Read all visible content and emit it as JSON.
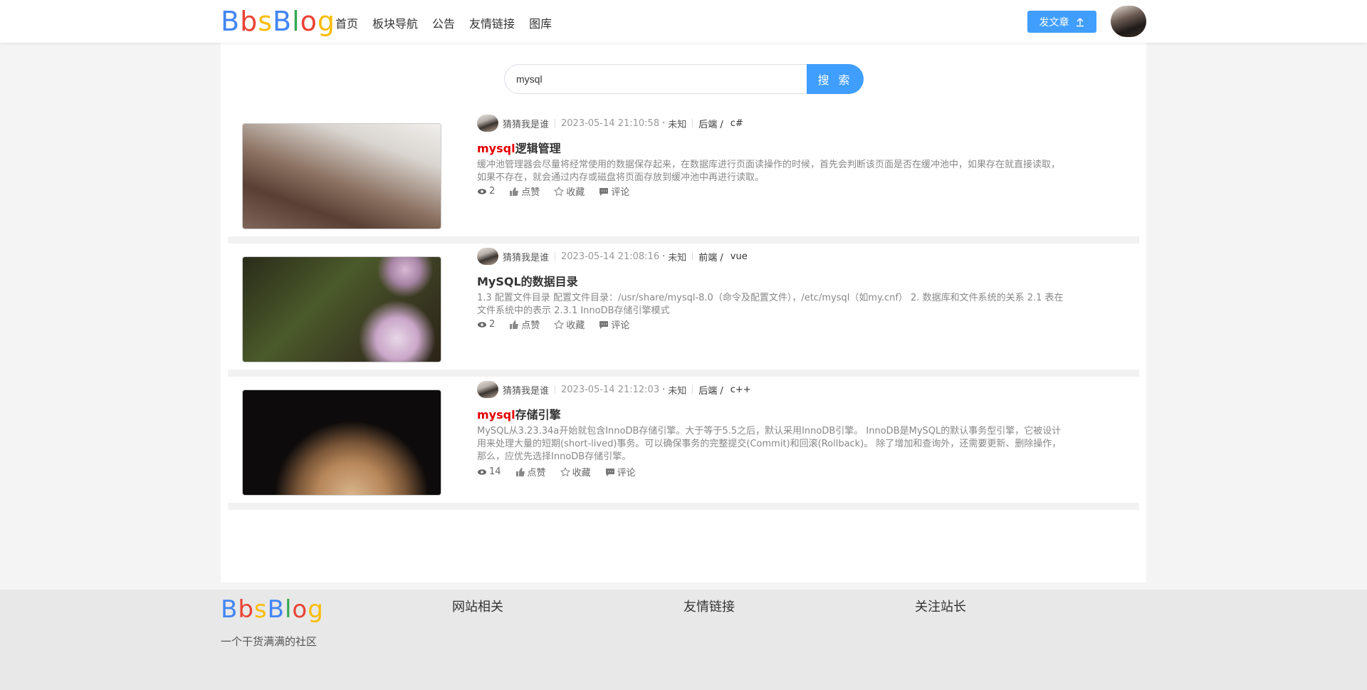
{
  "header": {
    "logo": [
      "B",
      "b",
      "s",
      "B",
      "l",
      "o",
      "g"
    ],
    "logo_colors": [
      "#4285f4",
      "#ea4335",
      "#fbbc05",
      "#4285f4",
      "#34a853",
      "#ea4335",
      "#fbbc05"
    ],
    "nav": [
      "首页",
      "板块导航",
      "公告",
      "友情链接",
      "图库"
    ],
    "post_button": "发文章"
  },
  "search": {
    "value": "mysql",
    "button": "搜 索"
  },
  "articles": [
    {
      "author": "猜猜我是谁",
      "date": "2023-05-14 21:10:58",
      "location": "未知",
      "category": "后端 /",
      "tag": "c#",
      "title_highlight": "mysql",
      "title_rest": "逻辑管理",
      "desc": "缓冲池管理器会尽量将经常使用的数据保存起来，在数据库进行页面读操作的时候，首先会判断该页面是否在缓冲池中，如果存在就直接读取，如果不存在，就会通过内存或磁盘将页面存放到缓冲池中再进行读取。",
      "views": "2",
      "like": "点赞",
      "collect": "收藏",
      "comment": "评论"
    },
    {
      "author": "猜猜我是谁",
      "date": "2023-05-14 21:08:16",
      "location": "未知",
      "category": "前端 /",
      "tag": "vue",
      "title_highlight": "",
      "title_rest": "MySQL的数据目录",
      "desc": "1.3 配置文件目录 配置文件目录：/usr/share/mysql-8.0（命令及配置文件），/etc/mysql（如my.cnf） 2. 数据库和文件系统的关系 2.1 表在文件系统中的表示 2.3.1 InnoDB存储引擎模式",
      "views": "2",
      "like": "点赞",
      "collect": "收藏",
      "comment": "评论"
    },
    {
      "author": "猜猜我是谁",
      "date": "2023-05-14 21:12:03",
      "location": "未知",
      "category": "后端 /",
      "tag": "c++",
      "title_highlight": "mysql",
      "title_rest": "存储引擎",
      "desc": "MySQL从3.23.34a开始就包含InnoDB存储引擎。大于等于5.5之后，默认采用InnoDB引擎。 InnoDB是MySQL的默认事务型引擎，它被设计用来处理大量的短期(short-lived)事务。可以确保事务的完整提交(Commit)和回滚(Rollback)。 除了增加和查询外，还需要更新、删除操作，那么，应优先选择InnoDB存储引擎。",
      "views": "14",
      "like": "点赞",
      "collect": "收藏",
      "comment": "评论"
    }
  ],
  "footer": {
    "slogan": "一个干货满满的社区",
    "columns": [
      "网站相关",
      "友情链接",
      "关注站长"
    ]
  }
}
